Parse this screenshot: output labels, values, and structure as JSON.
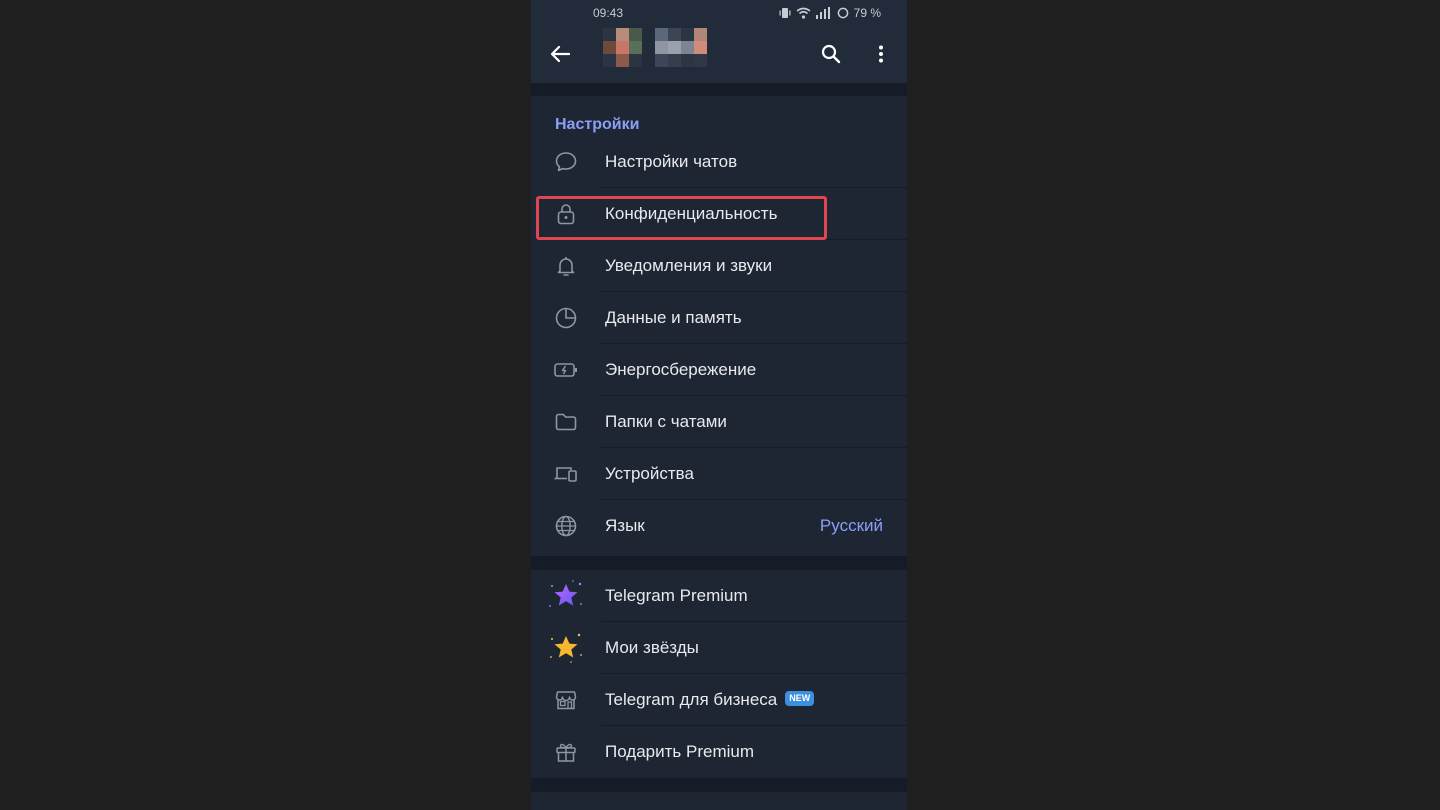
{
  "status_bar": {
    "time": "09:43",
    "battery": "79 %"
  },
  "header": {
    "back_icon": "arrow-left-icon",
    "search_icon": "search-icon",
    "more_icon": "more-vertical-icon"
  },
  "settings": {
    "section_title": "Настройки",
    "items": [
      {
        "label": "Настройки чатов",
        "icon": "chat-bubble-icon"
      },
      {
        "label": "Конфиденциальность",
        "icon": "lock-icon",
        "highlighted": true
      },
      {
        "label": "Уведомления и звуки",
        "icon": "bell-icon"
      },
      {
        "label": "Данные и память",
        "icon": "pie-chart-icon"
      },
      {
        "label": "Энергосбережение",
        "icon": "battery-icon"
      },
      {
        "label": "Папки с чатами",
        "icon": "folder-icon"
      },
      {
        "label": "Устройства",
        "icon": "devices-icon"
      },
      {
        "label": "Язык",
        "icon": "globe-icon",
        "value": "Русский"
      }
    ]
  },
  "premium": {
    "items": [
      {
        "label": "Telegram Premium",
        "icon": "premium-star-icon"
      },
      {
        "label": "Мои звёзды",
        "icon": "gold-star-icon"
      },
      {
        "label": "Telegram для бизнеса",
        "icon": "shop-icon",
        "badge": "NEW"
      },
      {
        "label": "Подарить Premium",
        "icon": "gift-icon"
      }
    ]
  },
  "colors": {
    "accent": "#8a9ff5",
    "highlight_border": "#e0464f",
    "badge": "#3d8fe0"
  }
}
